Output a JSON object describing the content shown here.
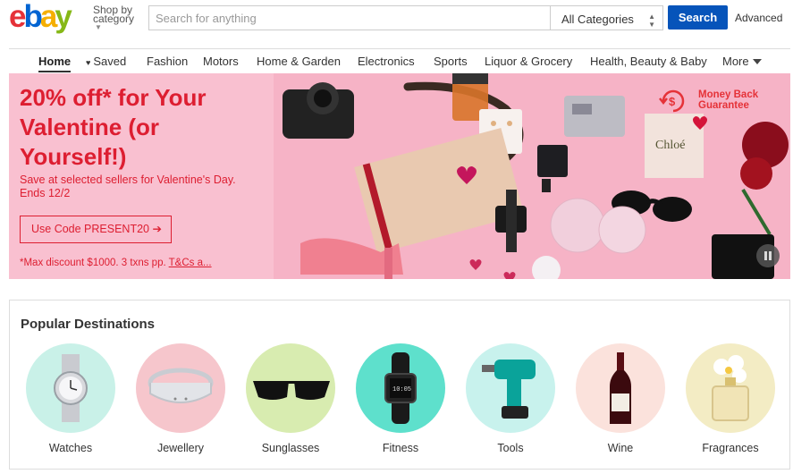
{
  "header": {
    "logo_letters": [
      "e",
      "b",
      "a",
      "y"
    ],
    "shop_by_line1": "Shop by",
    "shop_by_line2": "category",
    "search_placeholder": "Search for anything",
    "category_selected": "All Categories",
    "search_button": "Search",
    "advanced_link": "Advanced"
  },
  "nav": {
    "items": [
      {
        "label": "Home",
        "active": true
      },
      {
        "label": "Saved",
        "icon": "heart-icon"
      },
      {
        "label": "Fashion"
      },
      {
        "label": "Motors"
      },
      {
        "label": "Home & Garden"
      },
      {
        "label": "Electronics"
      },
      {
        "label": "Sports"
      },
      {
        "label": "Liquor & Grocery"
      },
      {
        "label": "Health, Beauty & Baby"
      },
      {
        "label": "More",
        "icon": "caret-down-icon"
      }
    ]
  },
  "banner": {
    "title": "20% off* for Your Valentine (or Yourself!)",
    "subtitle": "Save at selected sellers for Valentine's Day. Ends 12/2",
    "cta": "Use Code PRESENT20 ➔",
    "note": "*Max discount $1000. 3 txns pp. ",
    "note_link": "T&Cs a...",
    "badge_line1": "Money Back",
    "badge_line2": "Guarantee",
    "gift_tag": "Chloé",
    "accent_color": "#dd1e31"
  },
  "popular": {
    "title": "Popular Destinations",
    "items": [
      {
        "label": "Watches",
        "color": "#c9f1e8",
        "icon": "watch-icon"
      },
      {
        "label": "Jewellery",
        "color": "#f6c6cc",
        "icon": "bracelet-icon"
      },
      {
        "label": "Sunglasses",
        "color": "#d8ecb0",
        "icon": "sunglasses-icon"
      },
      {
        "label": "Fitness",
        "color": "#5ee0cc",
        "icon": "fitness-tracker-icon"
      },
      {
        "label": "Tools",
        "color": "#c8f2ed",
        "icon": "drill-icon"
      },
      {
        "label": "Wine",
        "color": "#fbe2dc",
        "icon": "wine-bottle-icon"
      },
      {
        "label": "Fragrances",
        "color": "#f3ecc4",
        "icon": "perfume-icon"
      }
    ]
  }
}
